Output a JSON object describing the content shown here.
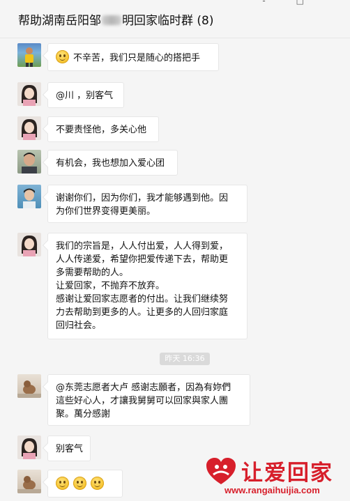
{
  "header": {
    "title_before": "帮助湖南岳阳邹",
    "title_after": "明回家临时群 (8)",
    "controls": [
      "-",
      "□",
      "×"
    ]
  },
  "messages": [
    {
      "avatar": "runner-avatar",
      "lines": [
        "不辛苦，我们只是随心的搭把手"
      ],
      "emoji_prefix": true
    },
    {
      "avatar": "girl-avatar",
      "lines": [
        "@川 ，别客气"
      ]
    },
    {
      "avatar": "girl-avatar",
      "lines": [
        "不要责怪他，多关心他"
      ]
    },
    {
      "avatar": "man-avatar",
      "lines": [
        "有机会，我也想加入爱心团"
      ]
    },
    {
      "avatar": "boy-avatar",
      "lines": [
        "谢谢你们，因为你们，我才能够遇到他。因",
        "为你们世界变得更美丽。"
      ]
    },
    {
      "avatar": "girl-avatar",
      "lines": [
        "我们的宗旨是，人人付出爱，人人得到爱，",
        "人人传递爱，希望你把爱传递下去，帮助更",
        "多需要帮助的人。",
        "让爱回家，不抛弃不放弃。",
        "感谢让爱回家志愿者的付出。让我们继续努",
        "力去帮助到更多的人。让更多的人回归家庭",
        "回归社会。"
      ]
    },
    {
      "avatar": "dog-avatar",
      "lines": [
        "@东莞志愿者大卢 感谢志願者，因為有妳們",
        "這些好心人，才讓我舅舅可以回家與家人團",
        "聚。萬分感謝"
      ]
    },
    {
      "avatar": "girl-avatar",
      "lines": [
        "别客气"
      ]
    },
    {
      "avatar": "dog-avatar",
      "lines": [],
      "emoji_count": 3
    }
  ],
  "timestamp": "昨天 16:36",
  "watermark": {
    "name": "让爱回家",
    "url": "www.rangaihuijia.com",
    "color": "#d71f2b"
  }
}
